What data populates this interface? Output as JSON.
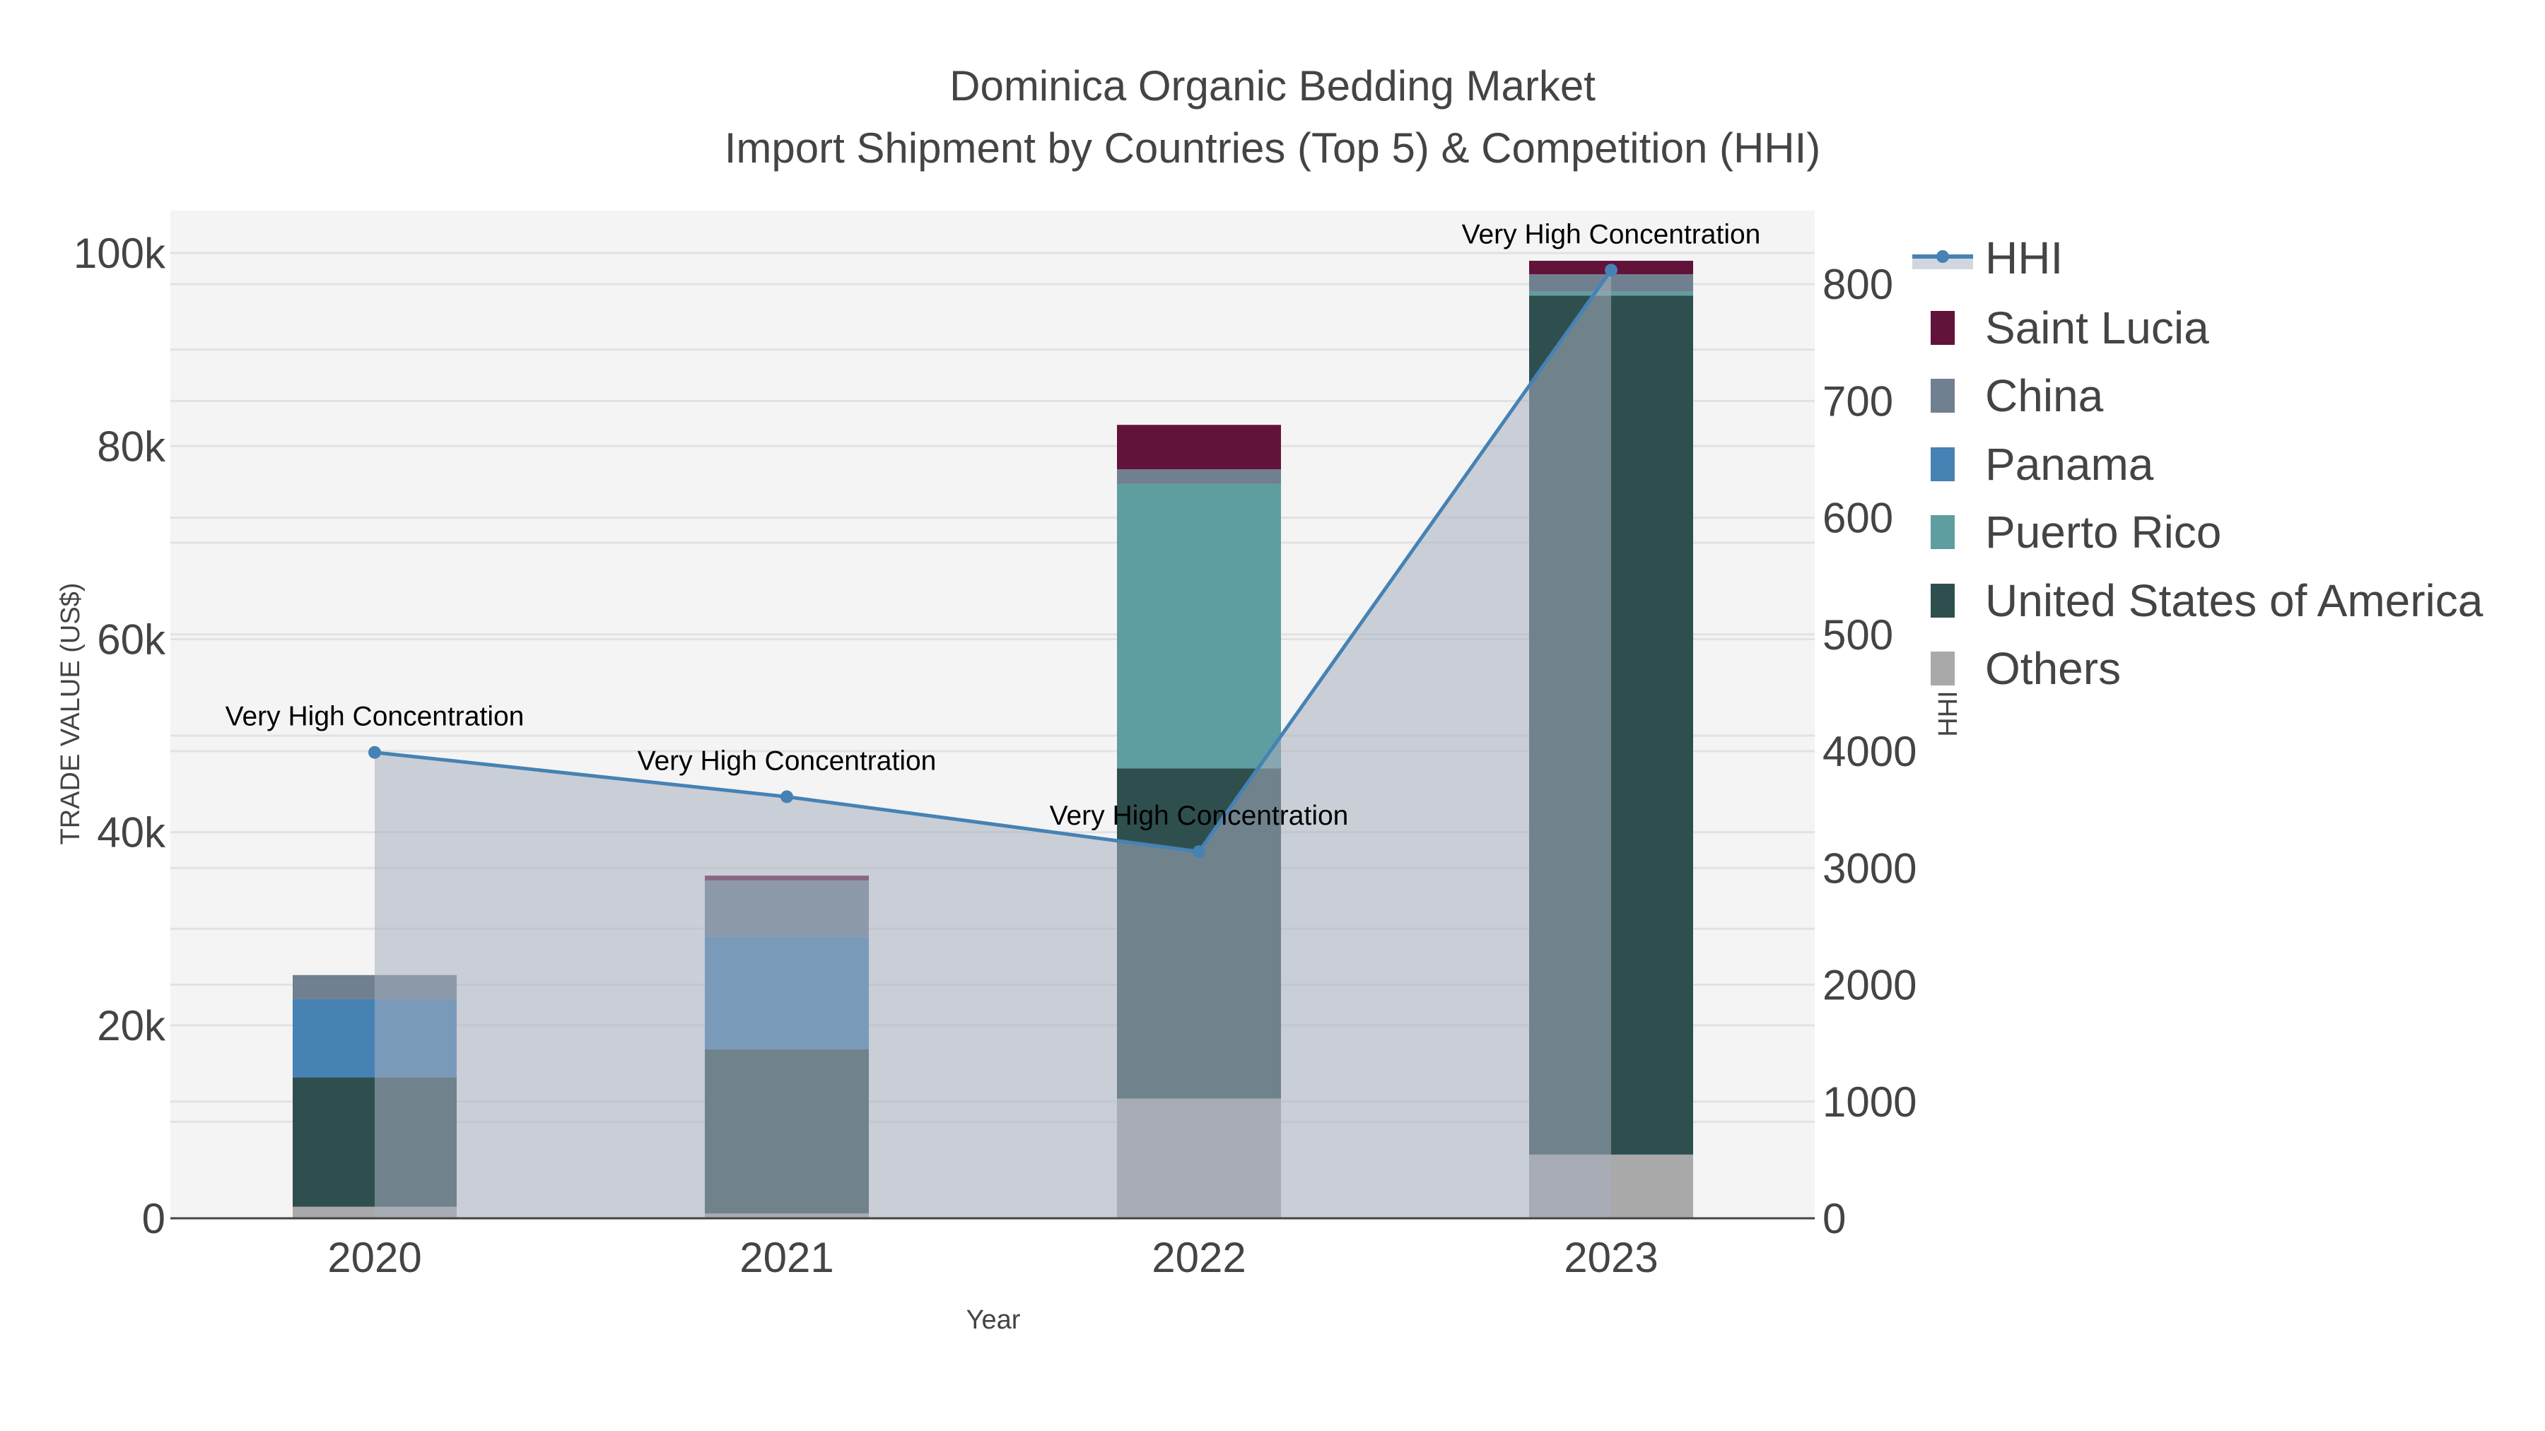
{
  "chart_data": {
    "type": "bar",
    "stacked": true,
    "title": "Dominica Organic Bedding Market",
    "subtitle": "Import Shipment by Countries (Top 5) & Competition (HHI)",
    "xlabel": "Year",
    "ylabel": "TRADE VALUE (US$)",
    "y2label": "HHI",
    "categories": [
      "2020",
      "2021",
      "2022",
      "2023"
    ],
    "ylim": [
      0,
      104400
    ],
    "y_ticks": [
      0,
      20000,
      40000,
      60000,
      80000,
      100000
    ],
    "y_tick_labels": [
      "0",
      "20k",
      "40k",
      "60k",
      "80k",
      "100k"
    ],
    "y2lim": [
      0,
      8630
    ],
    "y2_ticks": [
      0,
      1000,
      2000,
      3000,
      4000,
      5000,
      6000,
      7000,
      8000
    ],
    "y2_tick_labels": [
      "0",
      "1000",
      "2000",
      "3000",
      "4000",
      "500",
      "600",
      "700",
      "800"
    ],
    "series": [
      {
        "name": "Others",
        "color": "#a9a9a9",
        "values": [
          1200,
          500,
          12400,
          6600
        ]
      },
      {
        "name": "United States of America",
        "color": "#2f4f4f",
        "values": [
          13400,
          17000,
          34200,
          89000
        ]
      },
      {
        "name": "Puerto Rico",
        "color": "#5f9ea0",
        "values": [
          0,
          0,
          29500,
          400
        ]
      },
      {
        "name": "Panama",
        "color": "#4682b4",
        "values": [
          8100,
          11700,
          0,
          0
        ]
      },
      {
        "name": "China",
        "color": "#708090",
        "values": [
          2500,
          5800,
          1500,
          1800
        ]
      },
      {
        "name": "Saint Lucia",
        "color": "#62133a",
        "values": [
          0,
          500,
          4600,
          1400
        ]
      }
    ],
    "hhi": {
      "name": "HHI",
      "color": "#4682b4",
      "values": [
        3990,
        3610,
        3140,
        8120
      ]
    },
    "annotations": [
      "Very High Concentration",
      "Very High Concentration",
      "Very High Concentration",
      "Very High Concentration"
    ],
    "legend": [
      "HHI",
      "Saint Lucia",
      "China",
      "Panama",
      "Puerto Rico",
      "United States of America",
      "Others"
    ],
    "legend_placement": "right",
    "grid": true
  }
}
